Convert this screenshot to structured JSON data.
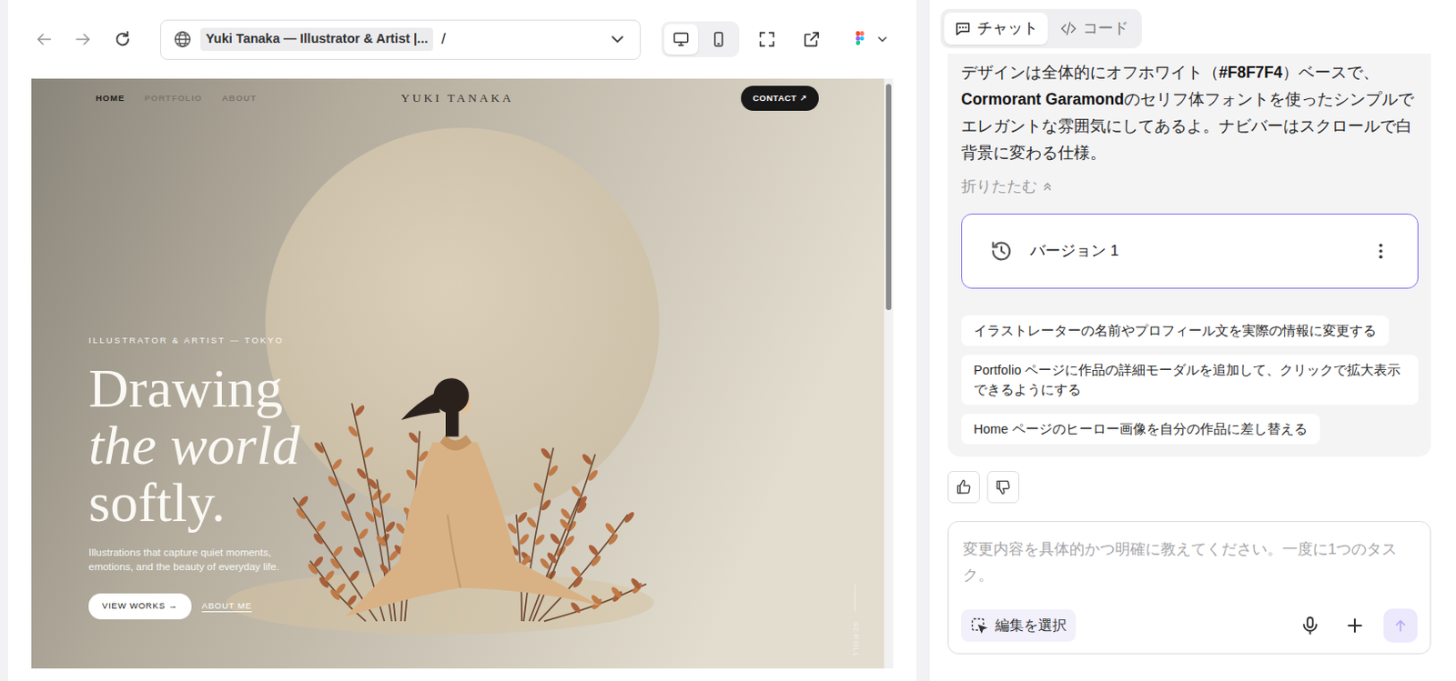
{
  "address_bar": {
    "title": "Yuki Tanaka — Illustrator & Artist |...",
    "path": "/"
  },
  "device_toggle": [
    {
      "kind": "desktop",
      "selected": true
    },
    {
      "kind": "mobile",
      "selected": false
    }
  ],
  "preview": {
    "nav_items": [
      {
        "label": "HOME",
        "selected": true
      },
      {
        "label": "PORTFOLIO",
        "selected": false
      },
      {
        "label": "ABOUT",
        "selected": false
      }
    ],
    "brand": "YUKI TANAKA",
    "contact": {
      "label": "CONTACT",
      "icon": "↗"
    },
    "eyebrow": "ILLUSTRATOR & ARTIST — TOKYO",
    "heading": [
      {
        "text": "Drawing",
        "kind": "upright"
      },
      {
        "text": "the world",
        "kind": "italic"
      },
      {
        "text": "softly.",
        "kind": "upright"
      }
    ],
    "subtitle": "Illustrations that capture quiet moments, emotions, and the beauty of everyday life.",
    "primary_button": {
      "label": "VIEW WORKS",
      "icon": "→"
    },
    "secondary_button": "ABOUT ME",
    "scroll_hint": "SCROLL",
    "scrollbar": {
      "level": 0.39
    }
  },
  "chat_panel": {
    "tabs": [
      {
        "label": "チャット",
        "selected": true
      },
      {
        "label": "コード",
        "selected": false
      }
    ],
    "message": [
      {
        "text": "デザインは全体的にオフホワイト（",
        "bold": false
      },
      {
        "text": "#F8F7F4",
        "bold": true
      },
      {
        "text": "）ベースで、",
        "bold": false
      },
      {
        "text": "Cormorant Garamond",
        "bold": true
      },
      {
        "text": "のセリフ体フォントを使ったシンプルでエレガントな雰囲気にしてあるよ。ナビバーはスクロールで白背景に変わる仕様。",
        "bold": false
      }
    ],
    "collapse": "折りたたむ",
    "version": "バージョン 1",
    "suggestions": [
      "イラストレーターの名前やプロフィール文を実際の情報に変更する",
      "Portfolio ページに作品の詳細モーダルを追加して、クリックで拡大表示できるようにする",
      "Home ページのヒーロー画像を自分の作品に差し替える"
    ],
    "input": {
      "placeholder": "変更内容を具体的かつ明確に教えてください。一度に1つのタスク。"
    },
    "select_edit": "編集を選択"
  }
}
